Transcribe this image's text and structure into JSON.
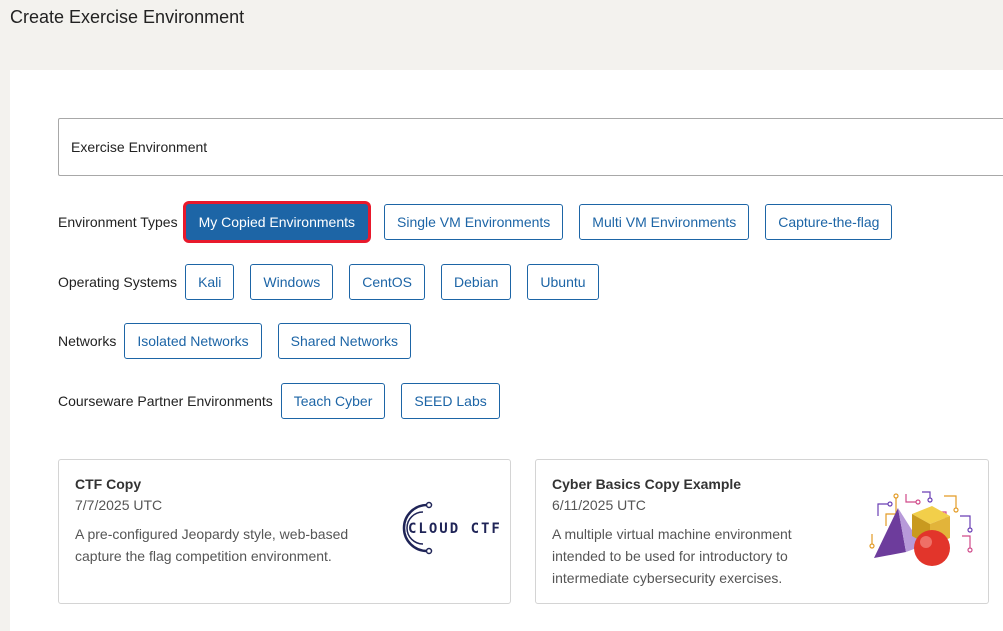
{
  "header": {
    "title": "Create Exercise Environment"
  },
  "search": {
    "value": "Exercise Environment"
  },
  "filters": {
    "environment_types": {
      "label": "Environment Types",
      "options": [
        "My Copied Environments",
        "Single VM Environments",
        "Multi VM Environments",
        "Capture-the-flag"
      ],
      "selected": "My Copied Environments"
    },
    "operating_systems": {
      "label": "Operating Systems",
      "options": [
        "Kali",
        "Windows",
        "CentOS",
        "Debian",
        "Ubuntu"
      ]
    },
    "networks": {
      "label": "Networks",
      "options": [
        "Isolated Networks",
        "Shared Networks"
      ]
    },
    "courseware": {
      "label": "Courseware Partner Environments",
      "options": [
        "Teach Cyber",
        "SEED Labs"
      ]
    }
  },
  "cards": [
    {
      "title": "CTF Copy",
      "date": "7/7/2025 UTC",
      "description_lines": [
        "A pre-configured Jeopardy style, web-based",
        "capture the flag competition environment."
      ],
      "logo": {
        "icon": "cloud-ctf-logo",
        "text": "CLOUD CTF"
      }
    },
    {
      "title": "Cyber Basics Copy Example",
      "date": "6/11/2025 UTC",
      "description_lines": [
        "A multiple virtual machine environment",
        "intended to be used for introductory to",
        "intermediate cybersecurity exercises."
      ],
      "logo": {
        "icon": "geometric-shapes-logo"
      }
    }
  ],
  "colors": {
    "accent": "#1d65a6",
    "selected_outline": "#e8192c",
    "background": "#f3f2ee"
  }
}
